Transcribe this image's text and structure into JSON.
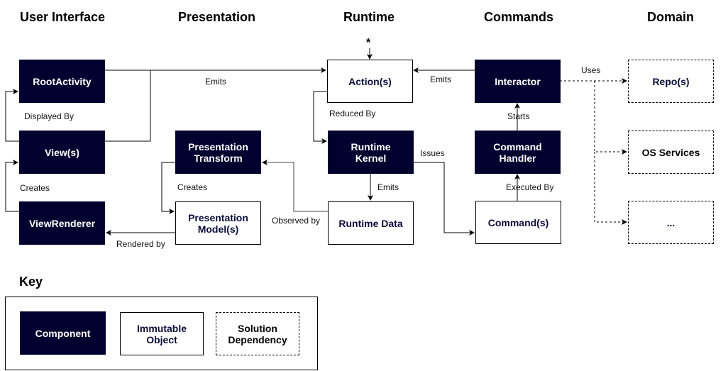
{
  "columns": {
    "user_interface": "User Interface",
    "presentation": "Presentation",
    "runtime": "Runtime",
    "commands": "Commands",
    "domain": "Domain"
  },
  "nodes": {
    "root_activity": {
      "label": "RootActivity",
      "kind": "component"
    },
    "views": {
      "label": "View(s)",
      "kind": "component"
    },
    "view_renderer": {
      "label": "ViewRenderer",
      "kind": "component"
    },
    "presentation_transform": {
      "label": "Presentation Transform",
      "kind": "component"
    },
    "presentation_models": {
      "label": "Presentation Model(s)",
      "kind": "immutable"
    },
    "actions": {
      "label": "Action(s)",
      "kind": "immutable"
    },
    "runtime_kernel": {
      "label": "Runtime Kernel",
      "kind": "component"
    },
    "runtime_data": {
      "label": "Runtime Data",
      "kind": "immutable"
    },
    "interactor": {
      "label": "Interactor",
      "kind": "component"
    },
    "command_handler": {
      "label": "Command Handler",
      "kind": "component"
    },
    "commands": {
      "label": "Command(s)",
      "kind": "immutable"
    },
    "repos": {
      "label": "Repo(s)",
      "kind": "dependency"
    },
    "os_services": {
      "label": "OS Services",
      "kind": "dependency"
    },
    "more": {
      "label": "...",
      "kind": "dependency"
    }
  },
  "edges": {
    "views_emits_actions": "Emits",
    "root_displayed_by_views": "Displayed By",
    "renderer_creates_views": "Creates",
    "models_rendered_by_renderer": "Rendered by",
    "transform_creates_models": "Creates",
    "data_observed_by_transform": "Observed by",
    "actions_reduced_by_kernel": "Reduced By",
    "kernel_emits_data": "Emits",
    "kernel_issues_commands": "Issues",
    "interactor_emits_actions": "Emits",
    "handler_starts_interactor": "Starts",
    "commands_executed_by_handler": "Executed By",
    "interactor_uses_domain": "Uses"
  },
  "external_input_marker": "*",
  "key": {
    "title": "Key",
    "component": "Component",
    "immutable": "Immutable Object",
    "dependency": "Solution Dependency"
  },
  "colors": {
    "component_fill": "#02002e",
    "component_text": "#ffffff",
    "immutable_text": "#0b0b3a",
    "line": "#000000"
  }
}
